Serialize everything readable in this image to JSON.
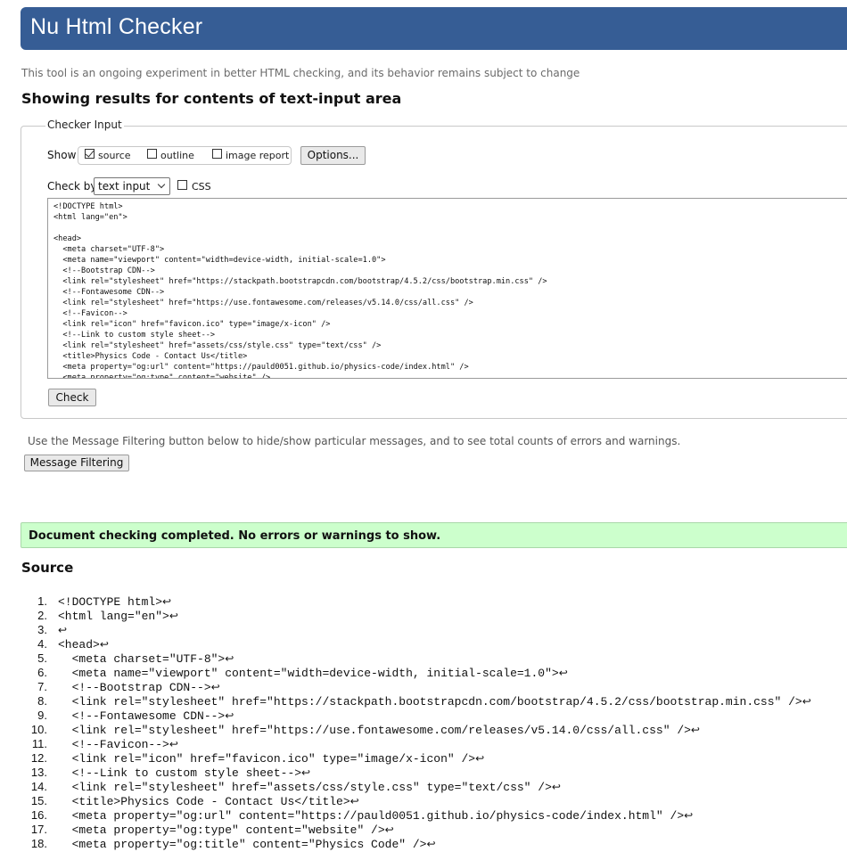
{
  "header": {
    "title": "Nu Html Checker"
  },
  "tagline": "This tool is an ongoing experiment in better HTML checking, and its behavior remains subject to change",
  "results_heading": "Showing results for contents of text-input area",
  "checker_input": {
    "legend": "Checker Input",
    "show_label": "Show",
    "options": [
      {
        "label": "source",
        "checked": true
      },
      {
        "label": "outline",
        "checked": false
      },
      {
        "label": "image report",
        "checked": false
      }
    ],
    "options_button": "Options...",
    "check_by_label": "Check by",
    "check_by_value": "text input",
    "css_label": "CSS",
    "css_checked": false,
    "textarea_content": "<!DOCTYPE html>\n<html lang=\"en\">\n\n<head>\n  <meta charset=\"UTF-8\">\n  <meta name=\"viewport\" content=\"width=device-width, initial-scale=1.0\">\n  <!--Bootstrap CDN-->\n  <link rel=\"stylesheet\" href=\"https://stackpath.bootstrapcdn.com/bootstrap/4.5.2/css/bootstrap.min.css\" />\n  <!--Fontawesome CDN-->\n  <link rel=\"stylesheet\" href=\"https://use.fontawesome.com/releases/v5.14.0/css/all.css\" />\n  <!--Favicon-->\n  <link rel=\"icon\" href=\"favicon.ico\" type=\"image/x-icon\" />\n  <!--Link to custom style sheet-->\n  <link rel=\"stylesheet\" href=\"assets/css/style.css\" type=\"text/css\" />\n  <title>Physics Code - Contact Us</title>\n  <meta property=\"og:url\" content=\"https://pauld0051.github.io/physics-code/index.html\" />\n  <meta property=\"og:type\" content=\"website\" />",
    "check_button": "Check"
  },
  "filter_note": "Use the Message Filtering button below to hide/show particular messages, and to see total counts of errors and warnings.",
  "message_filtering_button": "Message Filtering",
  "success_message": "Document checking completed. No errors or warnings to show.",
  "source_heading": "Source",
  "source_lines": [
    "<!DOCTYPE html>",
    "<html lang=\"en\">",
    "",
    "<head>",
    "  <meta charset=\"UTF-8\">",
    "  <meta name=\"viewport\" content=\"width=device-width, initial-scale=1.0\">",
    "  <!--Bootstrap CDN-->",
    "  <link rel=\"stylesheet\" href=\"https://stackpath.bootstrapcdn.com/bootstrap/4.5.2/css/bootstrap.min.css\" />",
    "  <!--Fontawesome CDN-->",
    "  <link rel=\"stylesheet\" href=\"https://use.fontawesome.com/releases/v5.14.0/css/all.css\" />",
    "  <!--Favicon-->",
    "  <link rel=\"icon\" href=\"favicon.ico\" type=\"image/x-icon\" />",
    "  <!--Link to custom style sheet-->",
    "  <link rel=\"stylesheet\" href=\"assets/css/style.css\" type=\"text/css\" />",
    "  <title>Physics Code - Contact Us</title>",
    "  <meta property=\"og:url\" content=\"https://pauld0051.github.io/physics-code/index.html\" />",
    "  <meta property=\"og:type\" content=\"website\" />",
    "  <meta property=\"og:title\" content=\"Physics Code\" />"
  ],
  "return_glyph": "↩",
  "colors": {
    "header_bg": "#365d95",
    "success_bg": "#ccffcc"
  }
}
